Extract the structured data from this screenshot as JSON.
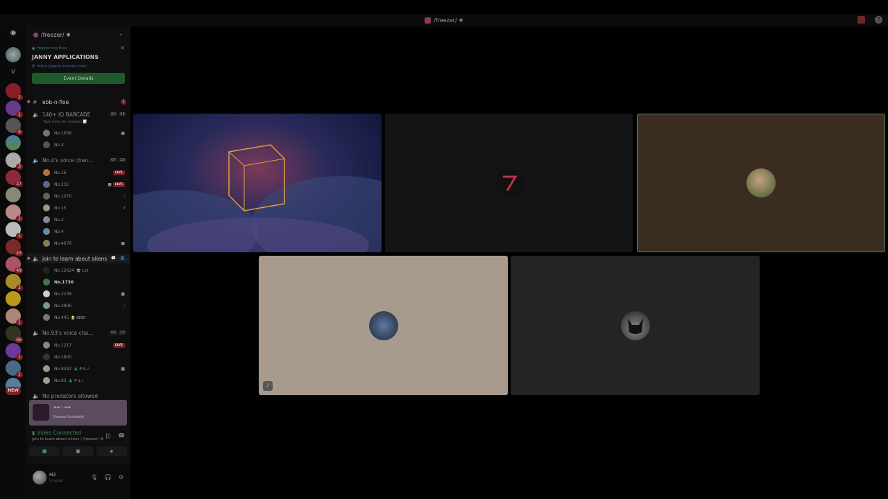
{
  "window": {
    "title": "/freezer/ ❅"
  },
  "rail": {
    "folder_letter": "V",
    "new_label": "NEW",
    "badges": [
      "2",
      "1",
      "6",
      "3",
      "27",
      "1",
      "1",
      "43",
      "49",
      "2",
      "1",
      "66",
      "1",
      "1"
    ]
  },
  "guild": {
    "name": "/freezer/ ❅"
  },
  "event": {
    "status": "Happening Now",
    "title": "JANNY APPLICATIONS",
    "link": "https://apply.maruko.chat/",
    "button": "Event Details"
  },
  "channels": {
    "text": {
      "name": "ebb-n-floe",
      "badge": "1"
    },
    "vc1": {
      "name": "140+ IQ BARCADE",
      "count_a": "02",
      "count_b": "25",
      "subtitle": "Type /help for answers 📝",
      "members": [
        {
          "name": "No.1658"
        },
        {
          "name": "No.X"
        }
      ]
    },
    "vc2": {
      "name": "No.4's voice chan...",
      "count_a": "07",
      "count_b": "25",
      "members": [
        {
          "name": "No.16",
          "live": "LIVE"
        },
        {
          "name": "No.232",
          "live": "LIVE"
        },
        {
          "name": "No.1070"
        },
        {
          "name": "No.15",
          "tag": "🎨 多謝"
        },
        {
          "name": "No.2",
          "tag": "💙 DIVE"
        },
        {
          "name": "No.4"
        },
        {
          "name": "No.4679"
        }
      ]
    },
    "vc3": {
      "name": "join to learn about aliens",
      "members": [
        {
          "name": "No.12624",
          "tag": "👽 115"
        },
        {
          "name": "No.1736"
        },
        {
          "name": "No.3238"
        },
        {
          "name": "No.3806"
        },
        {
          "name": "No.445",
          "tag": "🍺 BEER"
        }
      ]
    },
    "vc4": {
      "name": "No.93's voice cha...",
      "count_a": "04",
      "count_b": "25",
      "members": [
        {
          "name": "No.1217",
          "live": "LIVE"
        },
        {
          "name": "No.1800"
        },
        {
          "name": "No.8392",
          "tag": "🌲 チルノ"
        },
        {
          "name": "No.93",
          "tag": "🌲 チルノ"
        }
      ]
    },
    "vc5": {
      "name": "No predators allowed"
    }
  },
  "reward": {
    "title": "Reward Available!"
  },
  "voice": {
    "status": "Video Connected",
    "location": "join to learn about aliens / /freezer/ ❅"
  },
  "user": {
    "name": "H2",
    "state": "In voice"
  },
  "colors": {
    "tile_blank": "#141415",
    "tile_highlight": "#3a2c1f",
    "tile_beige": "#a89a8c",
    "tile_dark": "#242326",
    "speaking_border": "#5e8f5e",
    "live_red": "#7a1f22",
    "connected_green": "#3f8a52"
  }
}
